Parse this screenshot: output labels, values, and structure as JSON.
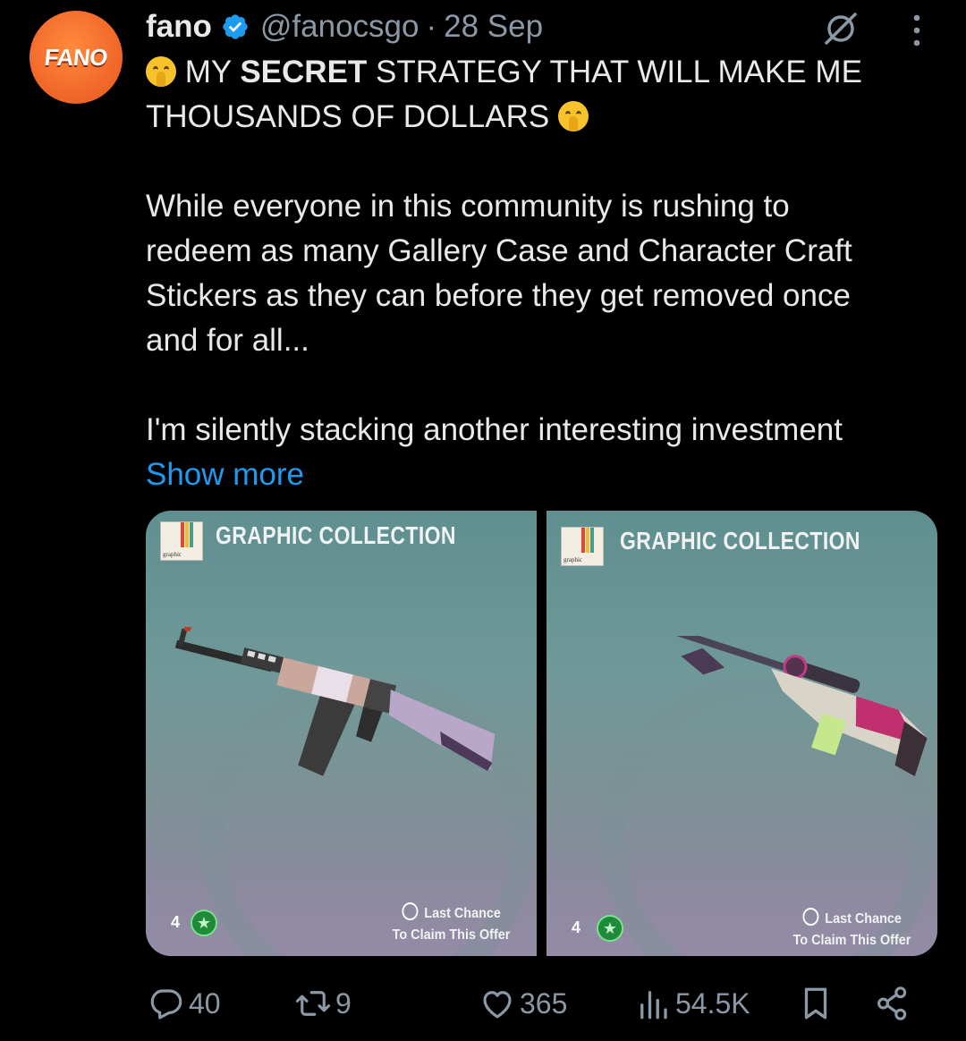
{
  "avatar": {
    "text": "FANO",
    "color": "#f2692a"
  },
  "header": {
    "name": "fano",
    "handle": "@fanocsgo",
    "separator": "·",
    "date": "28 Sep",
    "verified_icon": "verified-badge-icon",
    "grok_icon": "grok-icon",
    "more_icon": "more-vertical-icon"
  },
  "tweet": {
    "line1_pre": "MY ",
    "line1_bold": "SECRET",
    "line1_post": " STRATEGY THAT WILL MAKE ME",
    "line2": "THOUSANDS OF DOLLARS",
    "para2": [
      "While everyone in this community is rushing to",
      "redeem as many Gallery Case and Character Craft",
      "Stickers as they can before they get removed once",
      "and for all..."
    ],
    "para3": "I'm silently stacking another interesting investment",
    "show_more": "Show more",
    "emoji": "shushing-face"
  },
  "media": [
    {
      "title": "GRAPHIC COLLECTION",
      "badge_text": "graphic",
      "level": "4",
      "offer_line1": "Last Chance",
      "offer_line2": "To Claim This Offer",
      "weapon": "AK-47"
    },
    {
      "title": "GRAPHIC COLLECTION",
      "badge_text": "graphic",
      "level": "4",
      "offer_line1": "Last Chance",
      "offer_line2": "To Claim This Offer",
      "weapon": "AWP"
    }
  ],
  "actions": {
    "replies": "40",
    "reposts": "9",
    "likes": "365",
    "views": "54.5K",
    "reply_icon": "reply-icon",
    "repost_icon": "repost-icon",
    "like_icon": "heart-icon",
    "views_icon": "views-icon",
    "bookmark_icon": "bookmark-icon",
    "share_icon": "share-icon"
  },
  "colors": {
    "link": "#1d9bf0",
    "muted": "#8b98a5",
    "text": "#e7e9ea",
    "verified": "#1d9bf0"
  }
}
